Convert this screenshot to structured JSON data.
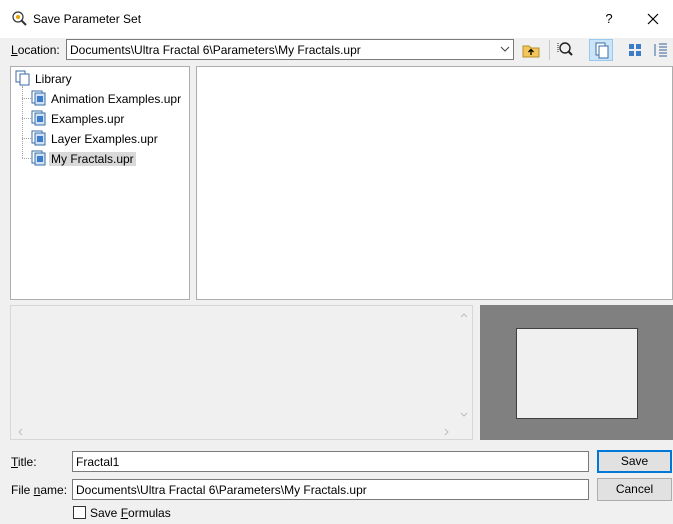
{
  "window": {
    "title": "Save Parameter Set",
    "help_glyph": "?",
    "icons": {
      "app": "fractal-app-icon",
      "close": "close-icon"
    }
  },
  "location": {
    "label_prefix": "",
    "label_underlined": "L",
    "label_rest": "ocation:",
    "value": "Documents\\Ultra Fractal 6\\Parameters\\My Fractals.upr",
    "toolbar": [
      {
        "name": "up-folder-icon"
      },
      {
        "name": "search-icon"
      },
      {
        "name": "view-tree-icon",
        "active": true
      },
      {
        "name": "view-icons-icon"
      },
      {
        "name": "view-details-icon"
      }
    ]
  },
  "tree": {
    "root": "Library",
    "items": [
      "Animation Examples.upr",
      "Examples.upr",
      "Layer Examples.upr",
      "My Fractals.upr"
    ],
    "selected_index": 3
  },
  "form": {
    "title_label_underlined": "T",
    "title_label_rest": "itle:",
    "title_value": "Fractal1",
    "filename_label_prefix": "File ",
    "filename_label_underlined": "n",
    "filename_label_rest": "ame:",
    "filename_value": "Documents\\Ultra Fractal 6\\Parameters\\My Fractals.upr",
    "save_label": "Save",
    "cancel_label": "Cancel",
    "checkbox_prefix": "Save ",
    "checkbox_underlined": "F",
    "checkbox_rest": "ormulas",
    "checkbox_checked": false
  },
  "colors": {
    "accent": "#0078d7",
    "selection": "#d9d9d9",
    "preview_bg": "#808080"
  }
}
